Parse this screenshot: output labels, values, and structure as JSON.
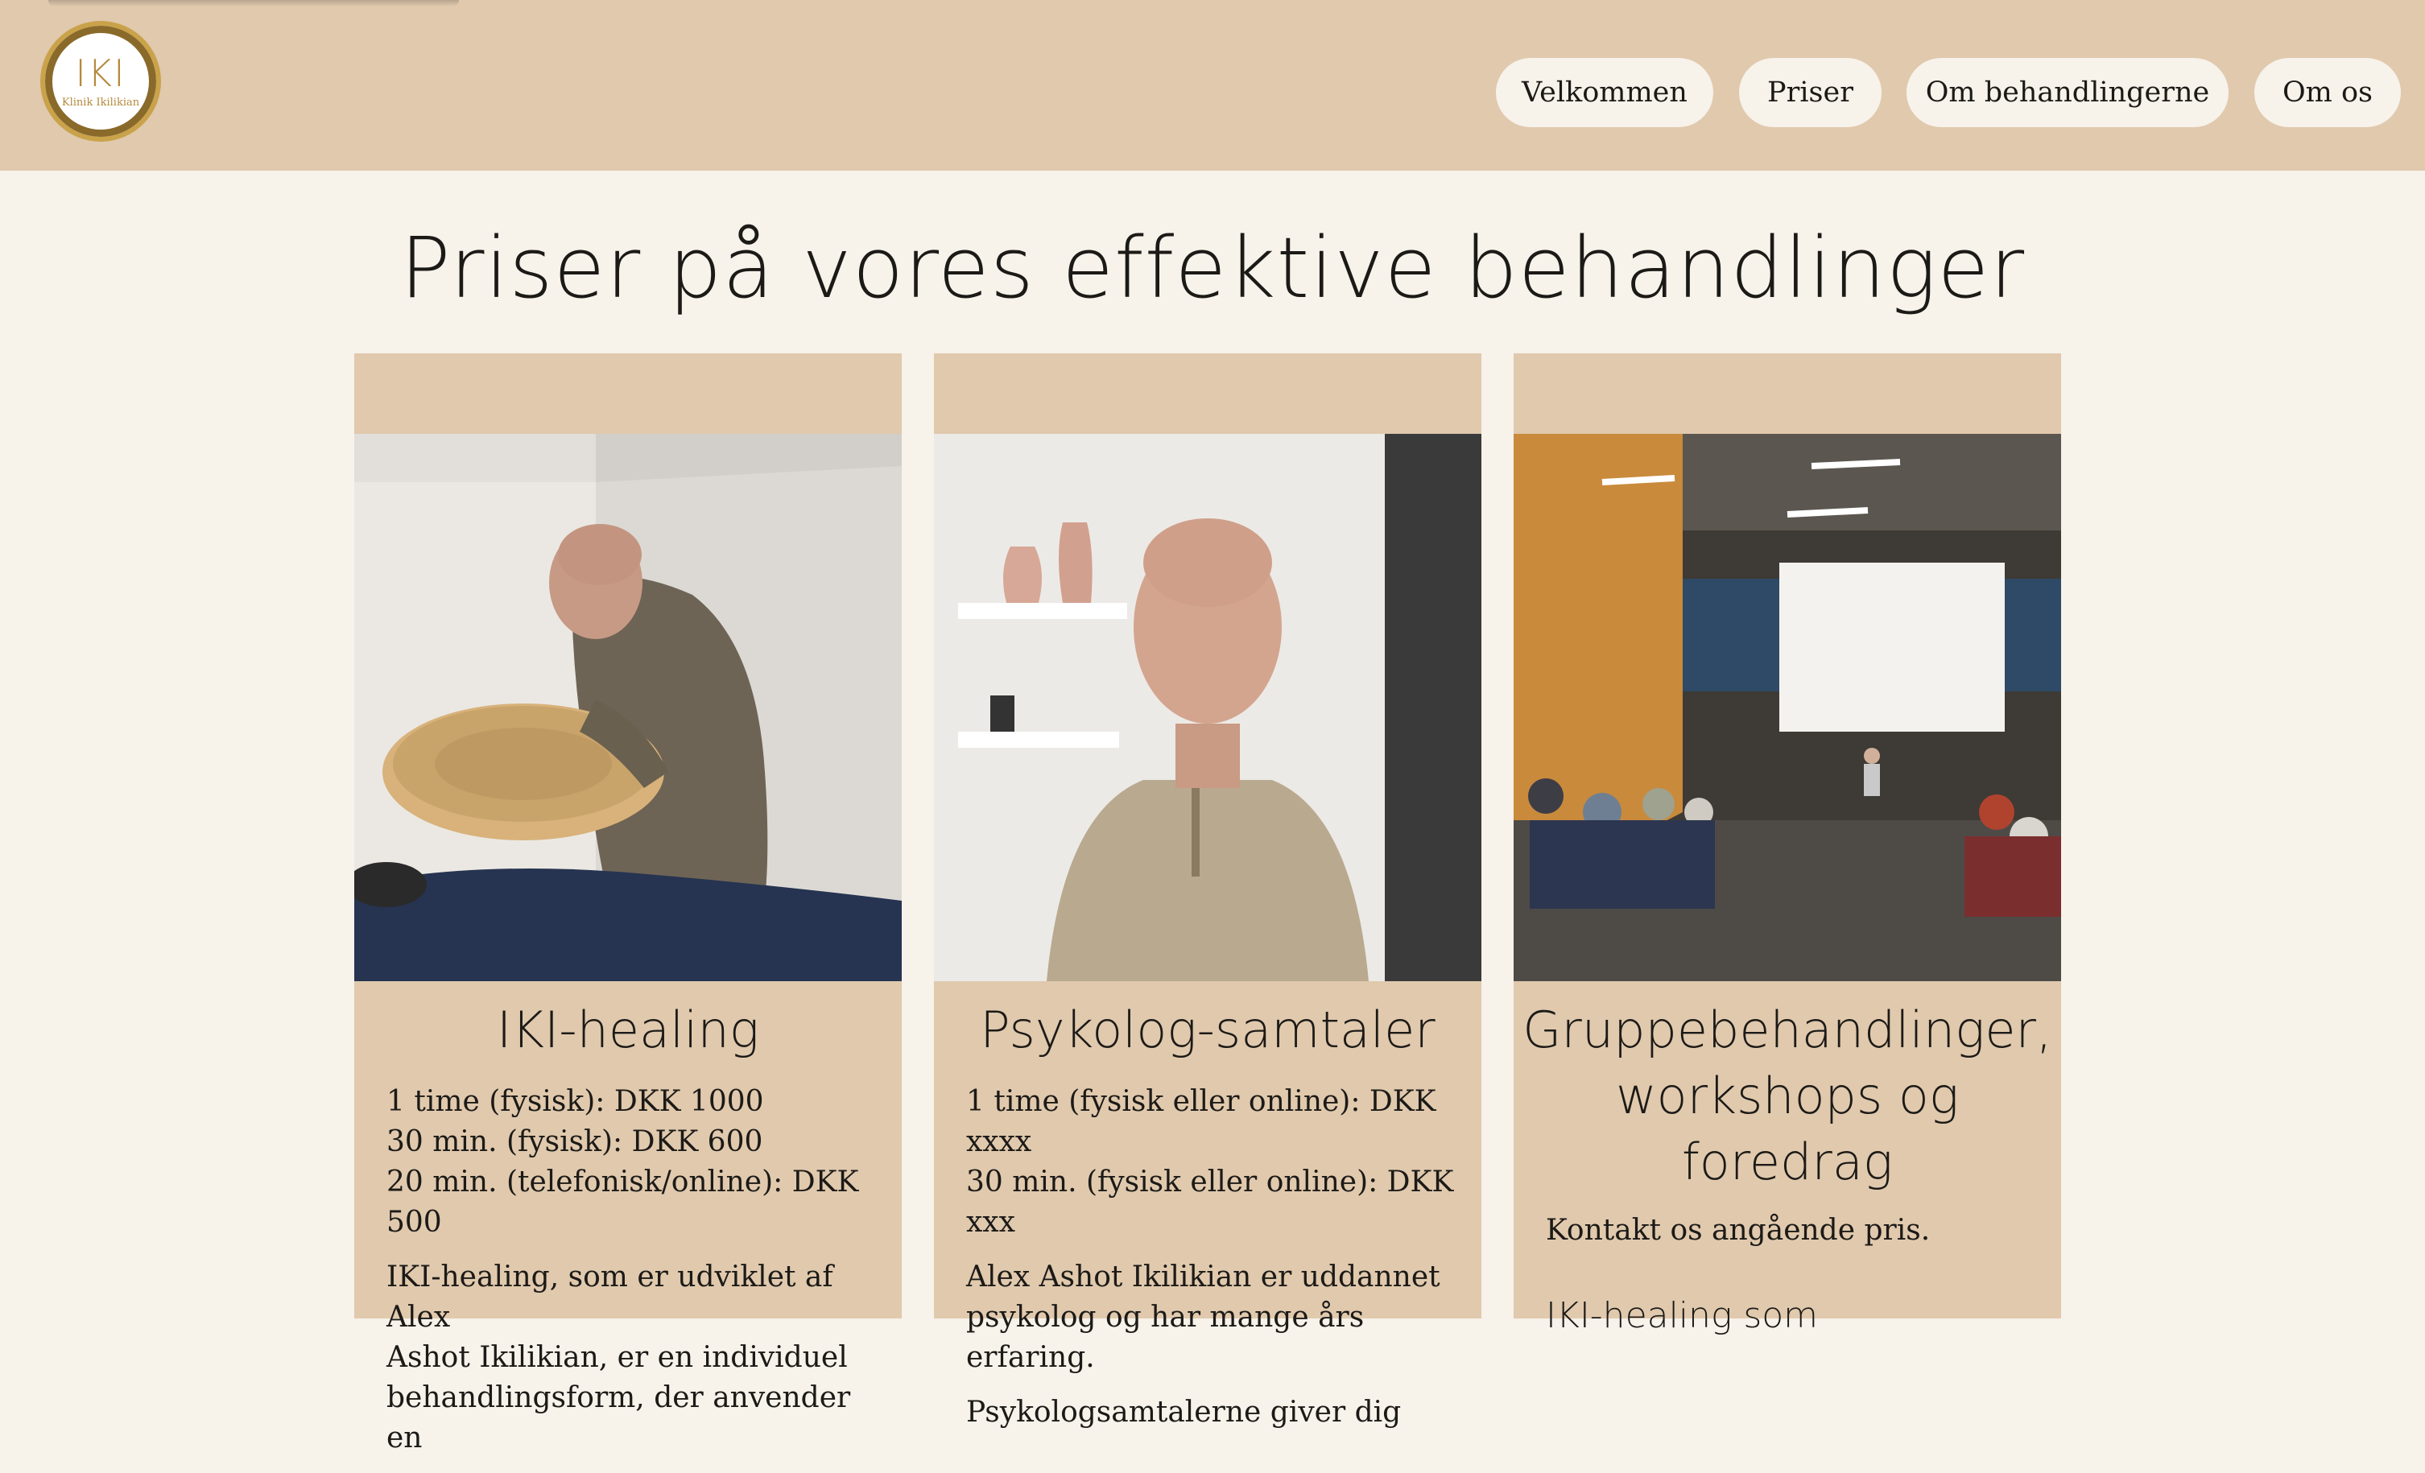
{
  "header": {
    "logo": {
      "mark": "IKI",
      "name": "Klinik Ikilikian"
    },
    "nav": [
      {
        "label": "Velkommen"
      },
      {
        "label": "Priser"
      },
      {
        "label": "Om behandlingerne"
      },
      {
        "label": "Om os"
      }
    ]
  },
  "main": {
    "title": "Priser på vores effektive behandlinger",
    "cards": [
      {
        "title": "IKI-healing",
        "prices": [
          "1 time (fysisk): DKK 1000",
          "30 min. (fysisk): DKK 600",
          "20 min. (telefonisk/online): DKK 500"
        ],
        "description_lines": [
          "IKI-healing, som er udviklet af Alex",
          "Ashot Ikilikian, er en individuel",
          "behandlingsform, der anvender en"
        ]
      },
      {
        "title": "Psykolog-samtaler",
        "prices": [
          "1 time (fysisk eller online): DKK xxxx",
          "30 min. (fysisk eller online): DKK xxx"
        ],
        "description_lines": [
          "Alex Ashot Ikilikian er uddannet",
          "psykolog og har mange års erfaring."
        ],
        "extra_line": "Psykologsamtalerne giver dig"
      },
      {
        "title_lines": [
          "Gruppebehandlinger,",
          "workshops og",
          "foredrag"
        ],
        "contact": "Kontakt os angående pris.",
        "footer_fragment": "IKI-healing som"
      }
    ]
  }
}
